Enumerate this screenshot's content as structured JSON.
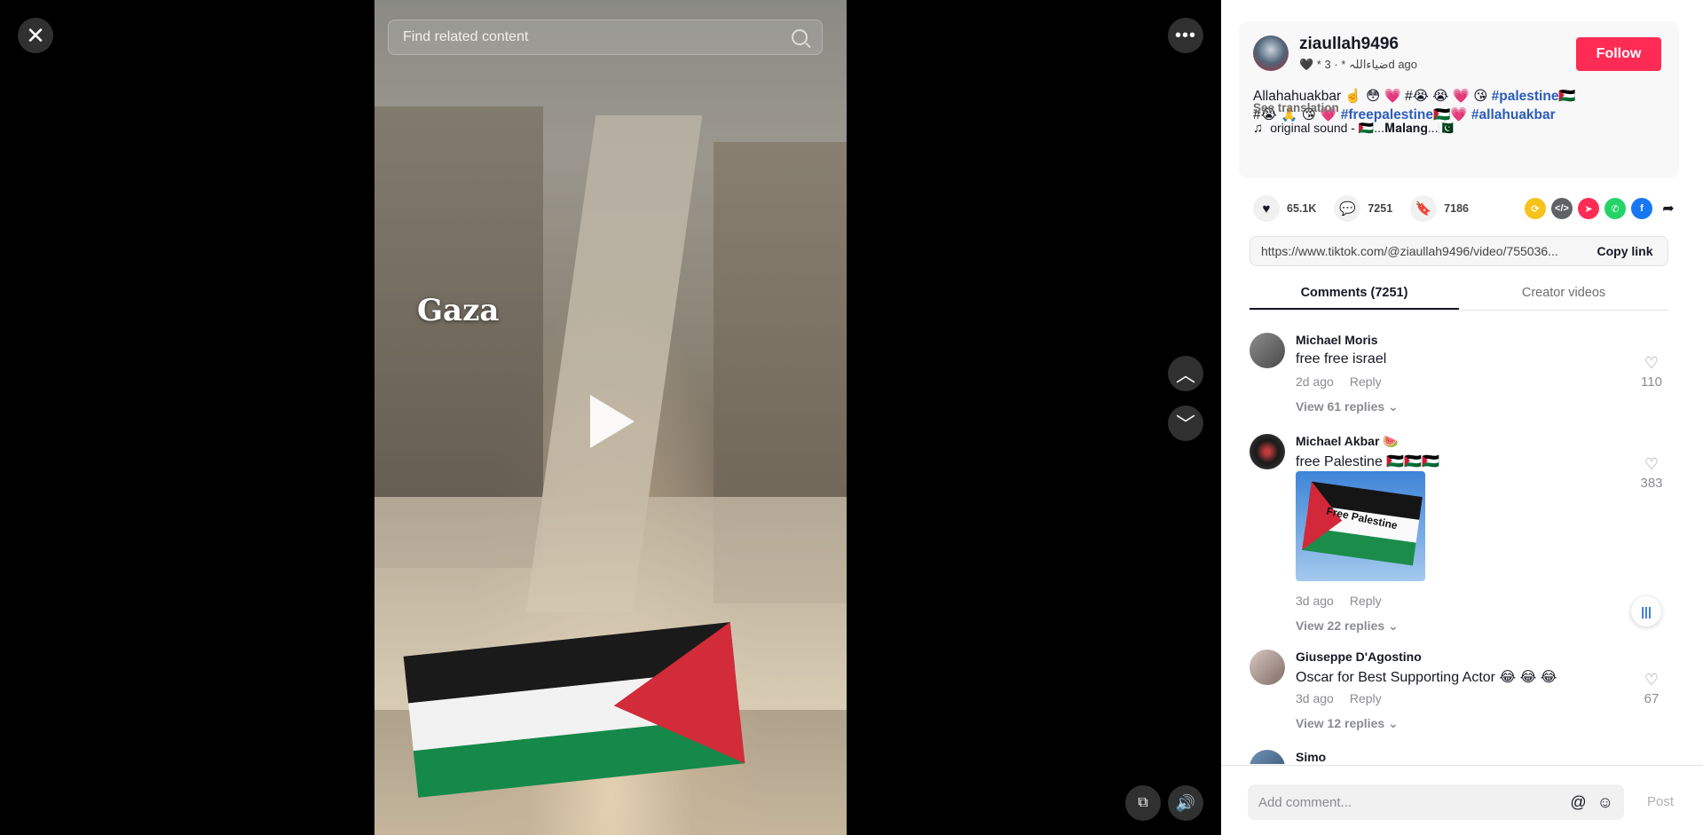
{
  "player": {
    "search_placeholder": "Find related content",
    "overlay_text": "Gaza",
    "close_icon": "close-icon",
    "more_icon": "more-icon",
    "up_icon": "chevron-up-icon",
    "down_icon": "chevron-down-icon"
  },
  "author": {
    "username": "ziaullah9496",
    "subline": "🖤 * ضیاءاللہ * · 3d ago",
    "follow_label": "Follow"
  },
  "description": {
    "text_prefix": "Allahahuakbar ☝️ 😳 💗 #",
    "emojis_mid": "😭 😭 💗 😘",
    "tag_palestine": "#palestine🇵🇸",
    "line2_prefix": "#😭 🙏 😘 💗",
    "tag_freepalestine": "#freepalestine🇵🇸💗",
    "tag_allahuakbar": "#allahuakbar",
    "see_translation": "See translation",
    "sound": "original sound - 🇵🇸...𝐌𝐚𝐥𝐚𝐧𝐠...🇵🇰"
  },
  "stats": {
    "likes": "65.1K",
    "comments": "7251",
    "saves": "7186"
  },
  "link": {
    "url": "https://www.tiktok.com/@ziaullah9496/video/755036...",
    "copy_label": "Copy link"
  },
  "tabs": {
    "comments": "Comments (7251)",
    "creator_videos": "Creator videos"
  },
  "comments": [
    {
      "name": "Michael Moris",
      "text": "free free israel",
      "time": "2d ago",
      "reply": "Reply",
      "replies": "View 61 replies",
      "likes": "110"
    },
    {
      "name": "Michael Akbar 🍉",
      "text": "free Palestine 🇵🇸🇵🇸🇵🇸",
      "time": "3d ago",
      "reply": "Reply",
      "replies": "View 22 replies",
      "likes": "383",
      "image_text": "Free Palestine"
    },
    {
      "name": "Giuseppe D'Agostino",
      "text": "Oscar for Best Supporting Actor 😂 😂 😂",
      "time": "3d ago",
      "reply": "Reply",
      "replies": "View 12 replies",
      "likes": "67"
    },
    {
      "name": "Simo"
    }
  ],
  "add_comment": {
    "placeholder": "Add comment...",
    "post_label": "Post"
  }
}
